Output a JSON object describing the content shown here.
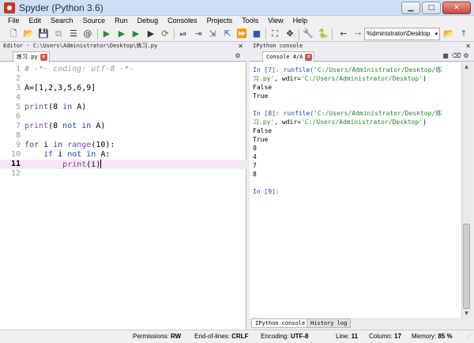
{
  "window": {
    "title": "Spyder (Python 3.6)",
    "minimize": "▁",
    "maximize": "□",
    "close": "✕"
  },
  "menu": [
    "File",
    "Edit",
    "Search",
    "Source",
    "Run",
    "Debug",
    "Consoles",
    "Projects",
    "Tools",
    "View",
    "Help"
  ],
  "toolbar": {
    "path": "%dministrator\\Desktop",
    "path_caret": "▾",
    "icons": {
      "new": "🗋",
      "open": "📂",
      "save": "💾",
      "save_all": "⧉",
      "list": "☰",
      "at": "@",
      "run": "▶",
      "run_cell": "▶",
      "run_cell_advance": "▶",
      "run_selection": "▶",
      "rerun": "⟳",
      "debug": "⏯",
      "step": "⇥",
      "step_into": "⇲",
      "step_return": "⇱",
      "continue": "⏩",
      "stop": "■",
      "maximize": "⛶",
      "fullscreen": "✥",
      "preferences": "🔧",
      "python": "🐍",
      "back": "←",
      "forward": "→",
      "browse": "📂",
      "parent": "↑"
    }
  },
  "editor": {
    "header": "Editor - C:\\Users\\Administrator\\Desktop\\练习.py",
    "tab": "练习.py",
    "tab_close": "✕",
    "options": "⚙",
    "current_line": 11,
    "lines": [
      {
        "n": "1",
        "html_tokens": [
          [
            "# -*- coding: utf-8 -*-",
            "t-comment"
          ]
        ]
      },
      {
        "n": "2",
        "html_tokens": []
      },
      {
        "n": "3",
        "html_tokens": [
          [
            "A=[1,2,3,5,6,9]",
            "t-plain"
          ]
        ]
      },
      {
        "n": "4",
        "html_tokens": []
      },
      {
        "n": "5",
        "html_tokens": [
          [
            "print",
            "t-fn"
          ],
          [
            "(8 ",
            "t-plain"
          ],
          [
            "in",
            "t-kw"
          ],
          [
            " A)",
            "t-plain"
          ]
        ]
      },
      {
        "n": "6",
        "html_tokens": []
      },
      {
        "n": "7",
        "html_tokens": [
          [
            "print",
            "t-fn"
          ],
          [
            "(8 ",
            "t-plain"
          ],
          [
            "not in",
            "t-kw"
          ],
          [
            " A)",
            "t-plain"
          ]
        ]
      },
      {
        "n": "8",
        "html_tokens": []
      },
      {
        "n": "9",
        "html_tokens": [
          [
            "for",
            "t-kw"
          ],
          [
            " i ",
            "t-plain"
          ],
          [
            "in",
            "t-kw"
          ],
          [
            " ",
            "t-plain"
          ],
          [
            "range",
            "t-fn"
          ],
          [
            "(10):",
            "t-plain"
          ]
        ]
      },
      {
        "n": "10",
        "html_tokens": [
          [
            "    ",
            "t-plain"
          ],
          [
            "if",
            "t-kw"
          ],
          [
            " i ",
            "t-plain"
          ],
          [
            "not in",
            "t-kw"
          ],
          [
            " A:",
            "t-plain"
          ]
        ]
      },
      {
        "n": "11",
        "html_tokens": [
          [
            "        ",
            "t-plain"
          ],
          [
            "print",
            "t-fn"
          ],
          [
            "(i)",
            "t-plain"
          ]
        ]
      },
      {
        "n": "12",
        "html_tokens": []
      }
    ]
  },
  "console": {
    "header": "IPython console",
    "tab": "Console 4/A",
    "tab_close": "✕",
    "icons": {
      "stop": "■",
      "clear": "⌫",
      "options": "⚙"
    },
    "lines": [
      [
        [
          "In [",
          "c-prompt"
        ],
        [
          "7",
          "c-prompt"
        ],
        [
          "]: runfile(",
          "c-prompt"
        ],
        [
          "'C:/Users/Administrator/Desktop/练",
          "c-str"
        ]
      ],
      [
        [
          "习.py'",
          "c-str"
        ],
        [
          ", wdir=",
          "c-out"
        ],
        [
          "'C:/Users/Administrator/Desktop'",
          "c-str"
        ],
        [
          ")",
          "c-out"
        ]
      ],
      [
        [
          "False",
          "c-out"
        ]
      ],
      [
        [
          "True",
          "c-out"
        ]
      ],
      [],
      [
        [
          "In [",
          "c-prompt"
        ],
        [
          "8",
          "c-prompt"
        ],
        [
          "]: runfile(",
          "c-prompt"
        ],
        [
          "'C:/Users/Administrator/Desktop/练",
          "c-str"
        ]
      ],
      [
        [
          "习.py'",
          "c-str"
        ],
        [
          ", wdir=",
          "c-out"
        ],
        [
          "'C:/Users/Administrator/Desktop'",
          "c-str"
        ],
        [
          ")",
          "c-out"
        ]
      ],
      [
        [
          "False",
          "c-out"
        ]
      ],
      [
        [
          "True",
          "c-out"
        ]
      ],
      [
        [
          "0",
          "c-out"
        ]
      ],
      [
        [
          "4",
          "c-out"
        ]
      ],
      [
        [
          "7",
          "c-out"
        ]
      ],
      [
        [
          "8",
          "c-out"
        ]
      ],
      [],
      [
        [
          "In [",
          "c-prompt"
        ],
        [
          "9",
          "c-prompt"
        ],
        [
          "]:",
          "c-prompt"
        ]
      ]
    ],
    "bottom_tabs": [
      "IPython console",
      "History log"
    ],
    "scroll_up": "▲",
    "scroll_down": "▼"
  },
  "status": {
    "permissions_label": "Permissions:",
    "permissions": "RW",
    "eol_label": "End-of-lines:",
    "eol": "CRLF",
    "encoding_label": "Encoding:",
    "encoding": "UTF-8",
    "line_label": "Line:",
    "line": "11",
    "column_label": "Column:",
    "column": "17",
    "memory_label": "Memory:",
    "memory": "85 %",
    "grip": "⋰"
  }
}
